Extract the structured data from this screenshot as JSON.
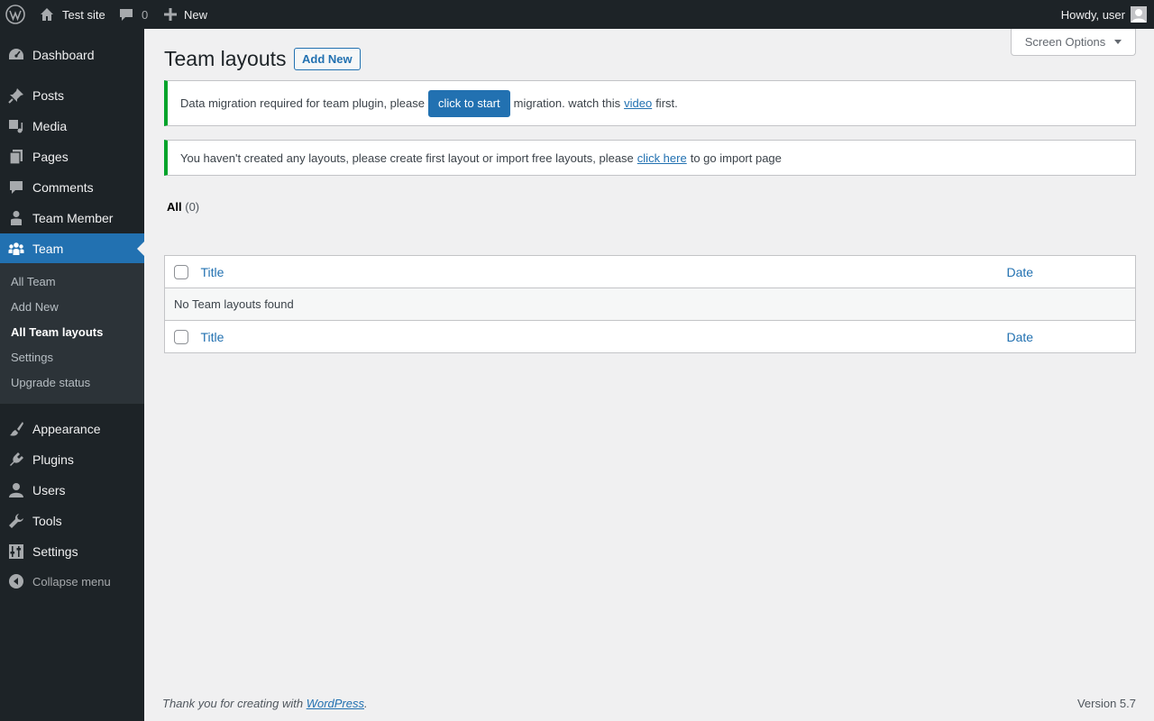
{
  "adminbar": {
    "site_name": "Test site",
    "comments_count": "0",
    "new_label": "New",
    "greeting": "Howdy, user"
  },
  "menu": {
    "items": [
      {
        "label": "Dashboard",
        "icon": "dashboard-icon"
      },
      {
        "label": "Posts",
        "icon": "pushpin-icon"
      },
      {
        "label": "Media",
        "icon": "media-icon"
      },
      {
        "label": "Pages",
        "icon": "pages-icon"
      },
      {
        "label": "Comments",
        "icon": "comment-icon"
      },
      {
        "label": "Team Member",
        "icon": "person-icon"
      },
      {
        "label": "Team",
        "icon": "groups-icon"
      },
      {
        "label": "Appearance",
        "icon": "paintbrush-icon"
      },
      {
        "label": "Plugins",
        "icon": "plugin-icon"
      },
      {
        "label": "Users",
        "icon": "users-icon"
      },
      {
        "label": "Tools",
        "icon": "wrench-icon"
      },
      {
        "label": "Settings",
        "icon": "settings-icon"
      }
    ],
    "submenu": [
      "All Team",
      "Add New",
      "All Team layouts",
      "Settings",
      "Upgrade status"
    ],
    "collapse_label": "Collapse menu"
  },
  "screen_options": "Screen Options",
  "page": {
    "title": "Team layouts",
    "add_new": "Add New"
  },
  "notices": {
    "migration": {
      "text_before": "Data migration required for team plugin, please",
      "button": "click to start",
      "text_middle": "migration. watch this",
      "link": "video",
      "text_after": "first."
    },
    "layouts": {
      "text_before": "You haven't created any layouts, please create first layout or import free layouts, please",
      "link": "click here",
      "text_after": "to go import page"
    }
  },
  "filters": {
    "all_label": "All",
    "all_count": "(0)"
  },
  "table": {
    "col_title": "Title",
    "col_date": "Date",
    "empty": "No Team layouts found"
  },
  "footer": {
    "thanks_before": "Thank you for creating with",
    "link": "WordPress",
    "thanks_after": ".",
    "version": "Version 5.7"
  },
  "colors": {
    "accent": "#2271b1",
    "sidebar": "#1d2327",
    "notice_success": "#00a32a"
  }
}
